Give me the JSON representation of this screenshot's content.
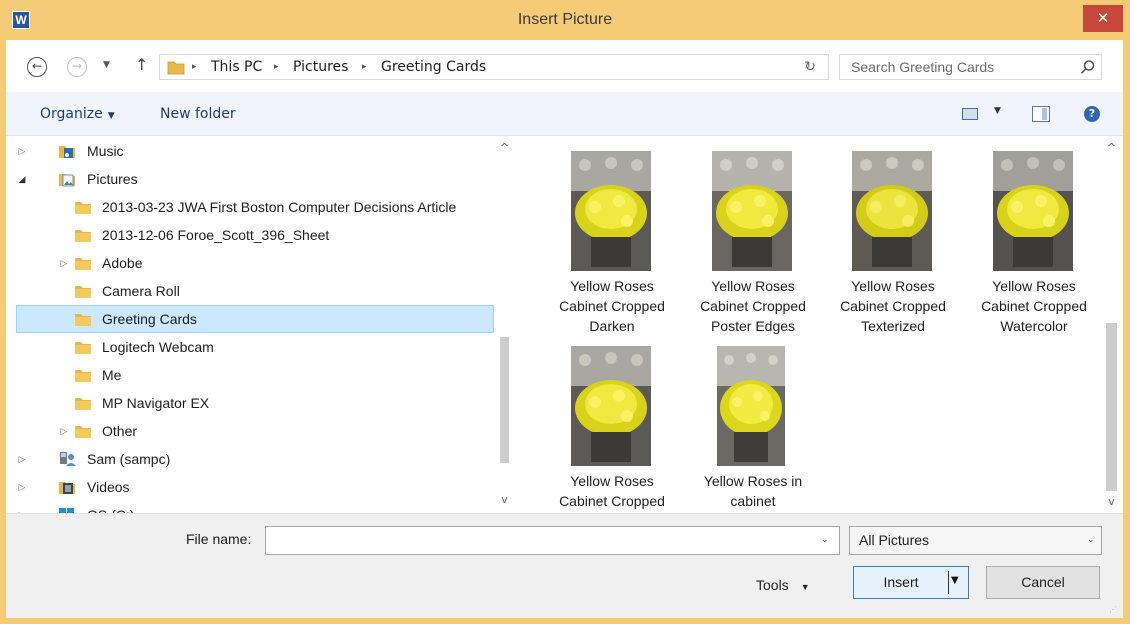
{
  "window": {
    "title": "Insert Picture",
    "app_icon_letter": "W",
    "close_glyph": "✕"
  },
  "nav": {
    "back_glyph": "←",
    "forward_glyph": "→",
    "recent_glyph": "▼",
    "up_glyph": "↑",
    "refresh_glyph": "↻",
    "address": {
      "separator": "▸",
      "crumbs": [
        "This PC",
        "Pictures",
        "Greeting Cards"
      ],
      "dropdown_glyph": "⌄"
    },
    "search": {
      "placeholder": "Search Greeting Cards"
    }
  },
  "command_bar": {
    "organize_label": "Organize",
    "new_folder_label": "New folder",
    "caret_glyph": "▼",
    "help_glyph": "?"
  },
  "tree": {
    "items": [
      {
        "label": "Music",
        "icon": "music-folder-icon",
        "expander": "▷",
        "level": 1
      },
      {
        "label": "Pictures",
        "icon": "pictures-folder-icon",
        "expander": "◢",
        "level": 1
      },
      {
        "label": "2013-03-23 JWA First Boston Computer Decisions Article",
        "icon": "folder-icon",
        "expander": "",
        "level": 2
      },
      {
        "label": "2013-12-06 Foroe_Scott_396_Sheet",
        "icon": "folder-icon",
        "expander": "",
        "level": 2
      },
      {
        "label": "Adobe",
        "icon": "folder-icon",
        "expander": "▷",
        "level": 2
      },
      {
        "label": "Camera Roll",
        "icon": "folder-icon",
        "expander": "",
        "level": 2
      },
      {
        "label": "Greeting Cards",
        "icon": "folder-icon",
        "expander": "",
        "level": 2,
        "selected": true
      },
      {
        "label": "Logitech Webcam",
        "icon": "folder-icon",
        "expander": "",
        "level": 2
      },
      {
        "label": "Me",
        "icon": "folder-icon",
        "expander": "",
        "level": 2
      },
      {
        "label": "MP Navigator EX",
        "icon": "folder-icon",
        "expander": "",
        "level": 2
      },
      {
        "label": "Other",
        "icon": "folder-icon",
        "expander": "▷",
        "level": 2
      },
      {
        "label": "Sam (sampc)",
        "icon": "user-icon",
        "expander": "▷",
        "level": 1
      },
      {
        "label": "Videos",
        "icon": "videos-folder-icon",
        "expander": "▷",
        "level": 1
      },
      {
        "label": "OS (C:)",
        "icon": "drive-icon",
        "expander": "▷",
        "level": 1
      }
    ],
    "scroll_up_glyph": "^",
    "scroll_down_glyph": "v"
  },
  "files": [
    {
      "lines": [
        "Yellow Roses",
        "Cabinet Cropped",
        "Darken"
      ]
    },
    {
      "lines": [
        "Yellow Roses",
        "Cabinet Cropped",
        "Poster Edges"
      ]
    },
    {
      "lines": [
        "Yellow Roses",
        "Cabinet Cropped",
        "Texterized"
      ]
    },
    {
      "lines": [
        "Yellow Roses",
        "Cabinet Cropped",
        "Watercolor"
      ]
    },
    {
      "lines": [
        "Yellow Roses",
        "Cabinet Cropped"
      ]
    },
    {
      "lines": [
        "Yellow Roses in",
        "cabinet"
      ]
    }
  ],
  "bottom": {
    "file_name_label": "File name:",
    "file_name_value": "",
    "dropdown_glyph": "⌄",
    "filter_value": "All Pictures",
    "tools_label": "Tools",
    "insert_label": "Insert",
    "insert_arrow_glyph": "▼",
    "cancel_label": "Cancel",
    "grip_glyph": "⋰"
  },
  "colors": {
    "title_bar": "#f5cc75",
    "close_button": "#c7473a",
    "selection_bg": "#cce8ff",
    "link_text": "#1e3f66",
    "folder": "#e8b84a"
  }
}
